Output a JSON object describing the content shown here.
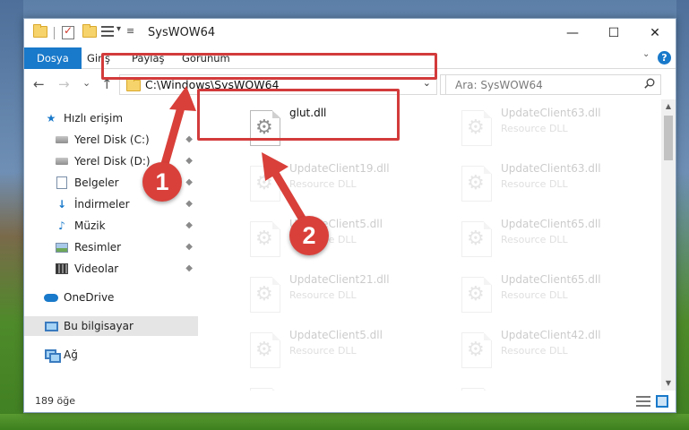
{
  "window": {
    "title": "SysWOW64",
    "controls": {
      "minimize": "—",
      "maximize": "☐",
      "close": "✕"
    }
  },
  "ribbon": {
    "tabs": [
      {
        "label": "Dosya",
        "active": true
      },
      {
        "label": "Giriş"
      },
      {
        "label": "Paylaş"
      },
      {
        "label": "Görünüm"
      }
    ],
    "expand_glyph": "⌄",
    "help_glyph": "?"
  },
  "nav": {
    "back_glyph": "←",
    "forward_glyph": "→",
    "recent_glyph": "⌄",
    "up_glyph": "↑",
    "address": "C:\\Windows\\SysWOW64",
    "address_dropdown_glyph": "⌄",
    "refresh_glyph": "↻",
    "search_placeholder": "Ara: SysWOW64"
  },
  "sidebar": {
    "items": [
      {
        "label": "Hızlı erişim",
        "icon": "star-icon"
      },
      {
        "label": "Yerel Disk (C:)",
        "icon": "drive-icon",
        "pinned": true
      },
      {
        "label": "Yerel Disk (D:)",
        "icon": "drive-icon",
        "pinned": true
      },
      {
        "label": "Belgeler",
        "icon": "documents-icon",
        "pinned": true
      },
      {
        "label": "İndirmeler",
        "icon": "downloads-icon",
        "pinned": true
      },
      {
        "label": "Müzik",
        "icon": "music-icon",
        "pinned": true
      },
      {
        "label": "Resimler",
        "icon": "pictures-icon",
        "pinned": true
      },
      {
        "label": "Videolar",
        "icon": "videos-icon",
        "pinned": true
      },
      {
        "label": "OneDrive",
        "icon": "cloud-icon"
      },
      {
        "label": "Bu bilgisayar",
        "icon": "computer-icon",
        "selected": true
      },
      {
        "label": "Ağ",
        "icon": "network-icon"
      }
    ],
    "pin_glyph": "📌"
  },
  "files": [
    {
      "name": "glut.dll",
      "type": ""
    },
    {
      "name": "UpdateClient63.dll",
      "type": "Resource DLL"
    },
    {
      "name": "UpdateClient19.dll",
      "type": "Resource DLL"
    },
    {
      "name": "UpdateClient63.dll",
      "type": "Resource DLL"
    },
    {
      "name": "UpdateClient5.dll",
      "type": "Resource DLL"
    },
    {
      "name": "UpdateClient65.dll",
      "type": "Resource DLL"
    },
    {
      "name": "UpdateClient21.dll",
      "type": "Resource DLL"
    },
    {
      "name": "UpdateClient65.dll",
      "type": "Resource DLL"
    },
    {
      "name": "UpdateClient5.dll",
      "type": "Resource DLL"
    },
    {
      "name": "UpdateClient42.dll",
      "type": "Resource DLL"
    }
  ],
  "status": {
    "item_count": "189 öğe"
  },
  "annotations": {
    "badge1": "1",
    "badge2": "2",
    "color": "#d9403a"
  },
  "colors": {
    "accent": "#1979ca",
    "highlight": "#d33b3b"
  }
}
